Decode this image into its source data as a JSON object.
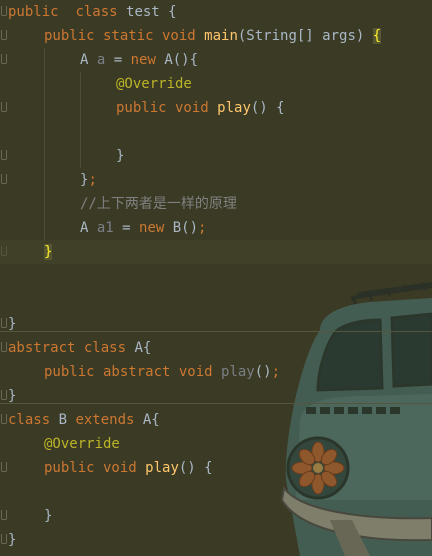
{
  "code_lines": [
    {
      "id": "l1",
      "tokens": [
        {
          "t": "public",
          "c": "kw"
        },
        {
          "t": "  ",
          "c": "plain"
        },
        {
          "t": "class",
          "c": "kw"
        },
        {
          "t": " test {",
          "c": "plain"
        }
      ]
    },
    {
      "id": "l2",
      "tokens": [
        {
          "t": "public static void ",
          "c": "kw"
        },
        {
          "t": "main",
          "c": "fn"
        },
        {
          "t": "(String[] args) ",
          "c": "plain"
        },
        {
          "t": "{",
          "c": "brace-hl"
        }
      ]
    },
    {
      "id": "l3",
      "tokens": [
        {
          "t": "A ",
          "c": "plain"
        },
        {
          "t": "a",
          "c": "dim"
        },
        {
          "t": " = ",
          "c": "plain"
        },
        {
          "t": "new ",
          "c": "kw"
        },
        {
          "t": "A(){",
          "c": "plain"
        }
      ]
    },
    {
      "id": "l4",
      "tokens": [
        {
          "t": "@Override",
          "c": "an"
        }
      ]
    },
    {
      "id": "l5",
      "tokens": [
        {
          "t": "public void ",
          "c": "kw"
        },
        {
          "t": "play",
          "c": "fn"
        },
        {
          "t": "() {",
          "c": "plain"
        }
      ]
    },
    {
      "id": "l6",
      "tokens": []
    },
    {
      "id": "l7",
      "tokens": [
        {
          "t": "}",
          "c": "plain"
        }
      ]
    },
    {
      "id": "l8",
      "tokens": [
        {
          "t": "}",
          "c": "plain"
        },
        {
          "t": ";",
          "c": "kw"
        }
      ]
    },
    {
      "id": "l9",
      "tokens": [
        {
          "t": "//上下两者是一样的原理",
          "c": "cm"
        }
      ]
    },
    {
      "id": "l10",
      "tokens": [
        {
          "t": "A ",
          "c": "plain"
        },
        {
          "t": "a1",
          "c": "dim"
        },
        {
          "t": " = ",
          "c": "plain"
        },
        {
          "t": "new ",
          "c": "kw"
        },
        {
          "t": "B()",
          "c": "plain"
        },
        {
          "t": ";",
          "c": "kw"
        }
      ]
    },
    {
      "id": "l11",
      "tokens": [
        {
          "t": "}",
          "c": "brace-hl"
        }
      ]
    },
    {
      "id": "l12",
      "tokens": []
    },
    {
      "id": "l13",
      "tokens": []
    },
    {
      "id": "l14",
      "tokens": [
        {
          "t": "}",
          "c": "plain"
        }
      ]
    },
    {
      "id": "l15",
      "tokens": [
        {
          "t": "abstract class ",
          "c": "kw"
        },
        {
          "t": "A{",
          "c": "plain"
        }
      ]
    },
    {
      "id": "l16",
      "tokens": [
        {
          "t": "public abstract void ",
          "c": "kw"
        },
        {
          "t": "play",
          "c": "dim"
        },
        {
          "t": "()",
          "c": "plain"
        },
        {
          "t": ";",
          "c": "kw"
        }
      ]
    },
    {
      "id": "l17",
      "tokens": [
        {
          "t": "}",
          "c": "plain"
        }
      ]
    },
    {
      "id": "l18",
      "tokens": [
        {
          "t": "class ",
          "c": "kw"
        },
        {
          "t": "B ",
          "c": "plain"
        },
        {
          "t": "extends ",
          "c": "kw"
        },
        {
          "t": "A{",
          "c": "plain"
        }
      ]
    },
    {
      "id": "l19",
      "tokens": [
        {
          "t": "@Override",
          "c": "an"
        }
      ]
    },
    {
      "id": "l20",
      "tokens": [
        {
          "t": "public void ",
          "c": "kw"
        },
        {
          "t": "play",
          "c": "fn"
        },
        {
          "t": "() {",
          "c": "plain"
        }
      ]
    },
    {
      "id": "l21",
      "tokens": []
    },
    {
      "id": "l22",
      "tokens": [
        {
          "t": "}",
          "c": "plain"
        }
      ]
    },
    {
      "id": "l23",
      "tokens": [
        {
          "t": "}",
          "c": "plain"
        }
      ]
    }
  ],
  "background_image": "van-illustration",
  "colors": {
    "background": "#3b3a24",
    "keyword": "#cc7832",
    "function": "#ffc66d",
    "annotation": "#bbb529",
    "text": "#a9b7c6",
    "comment": "#808080",
    "brace_highlight": "#ffef28"
  }
}
